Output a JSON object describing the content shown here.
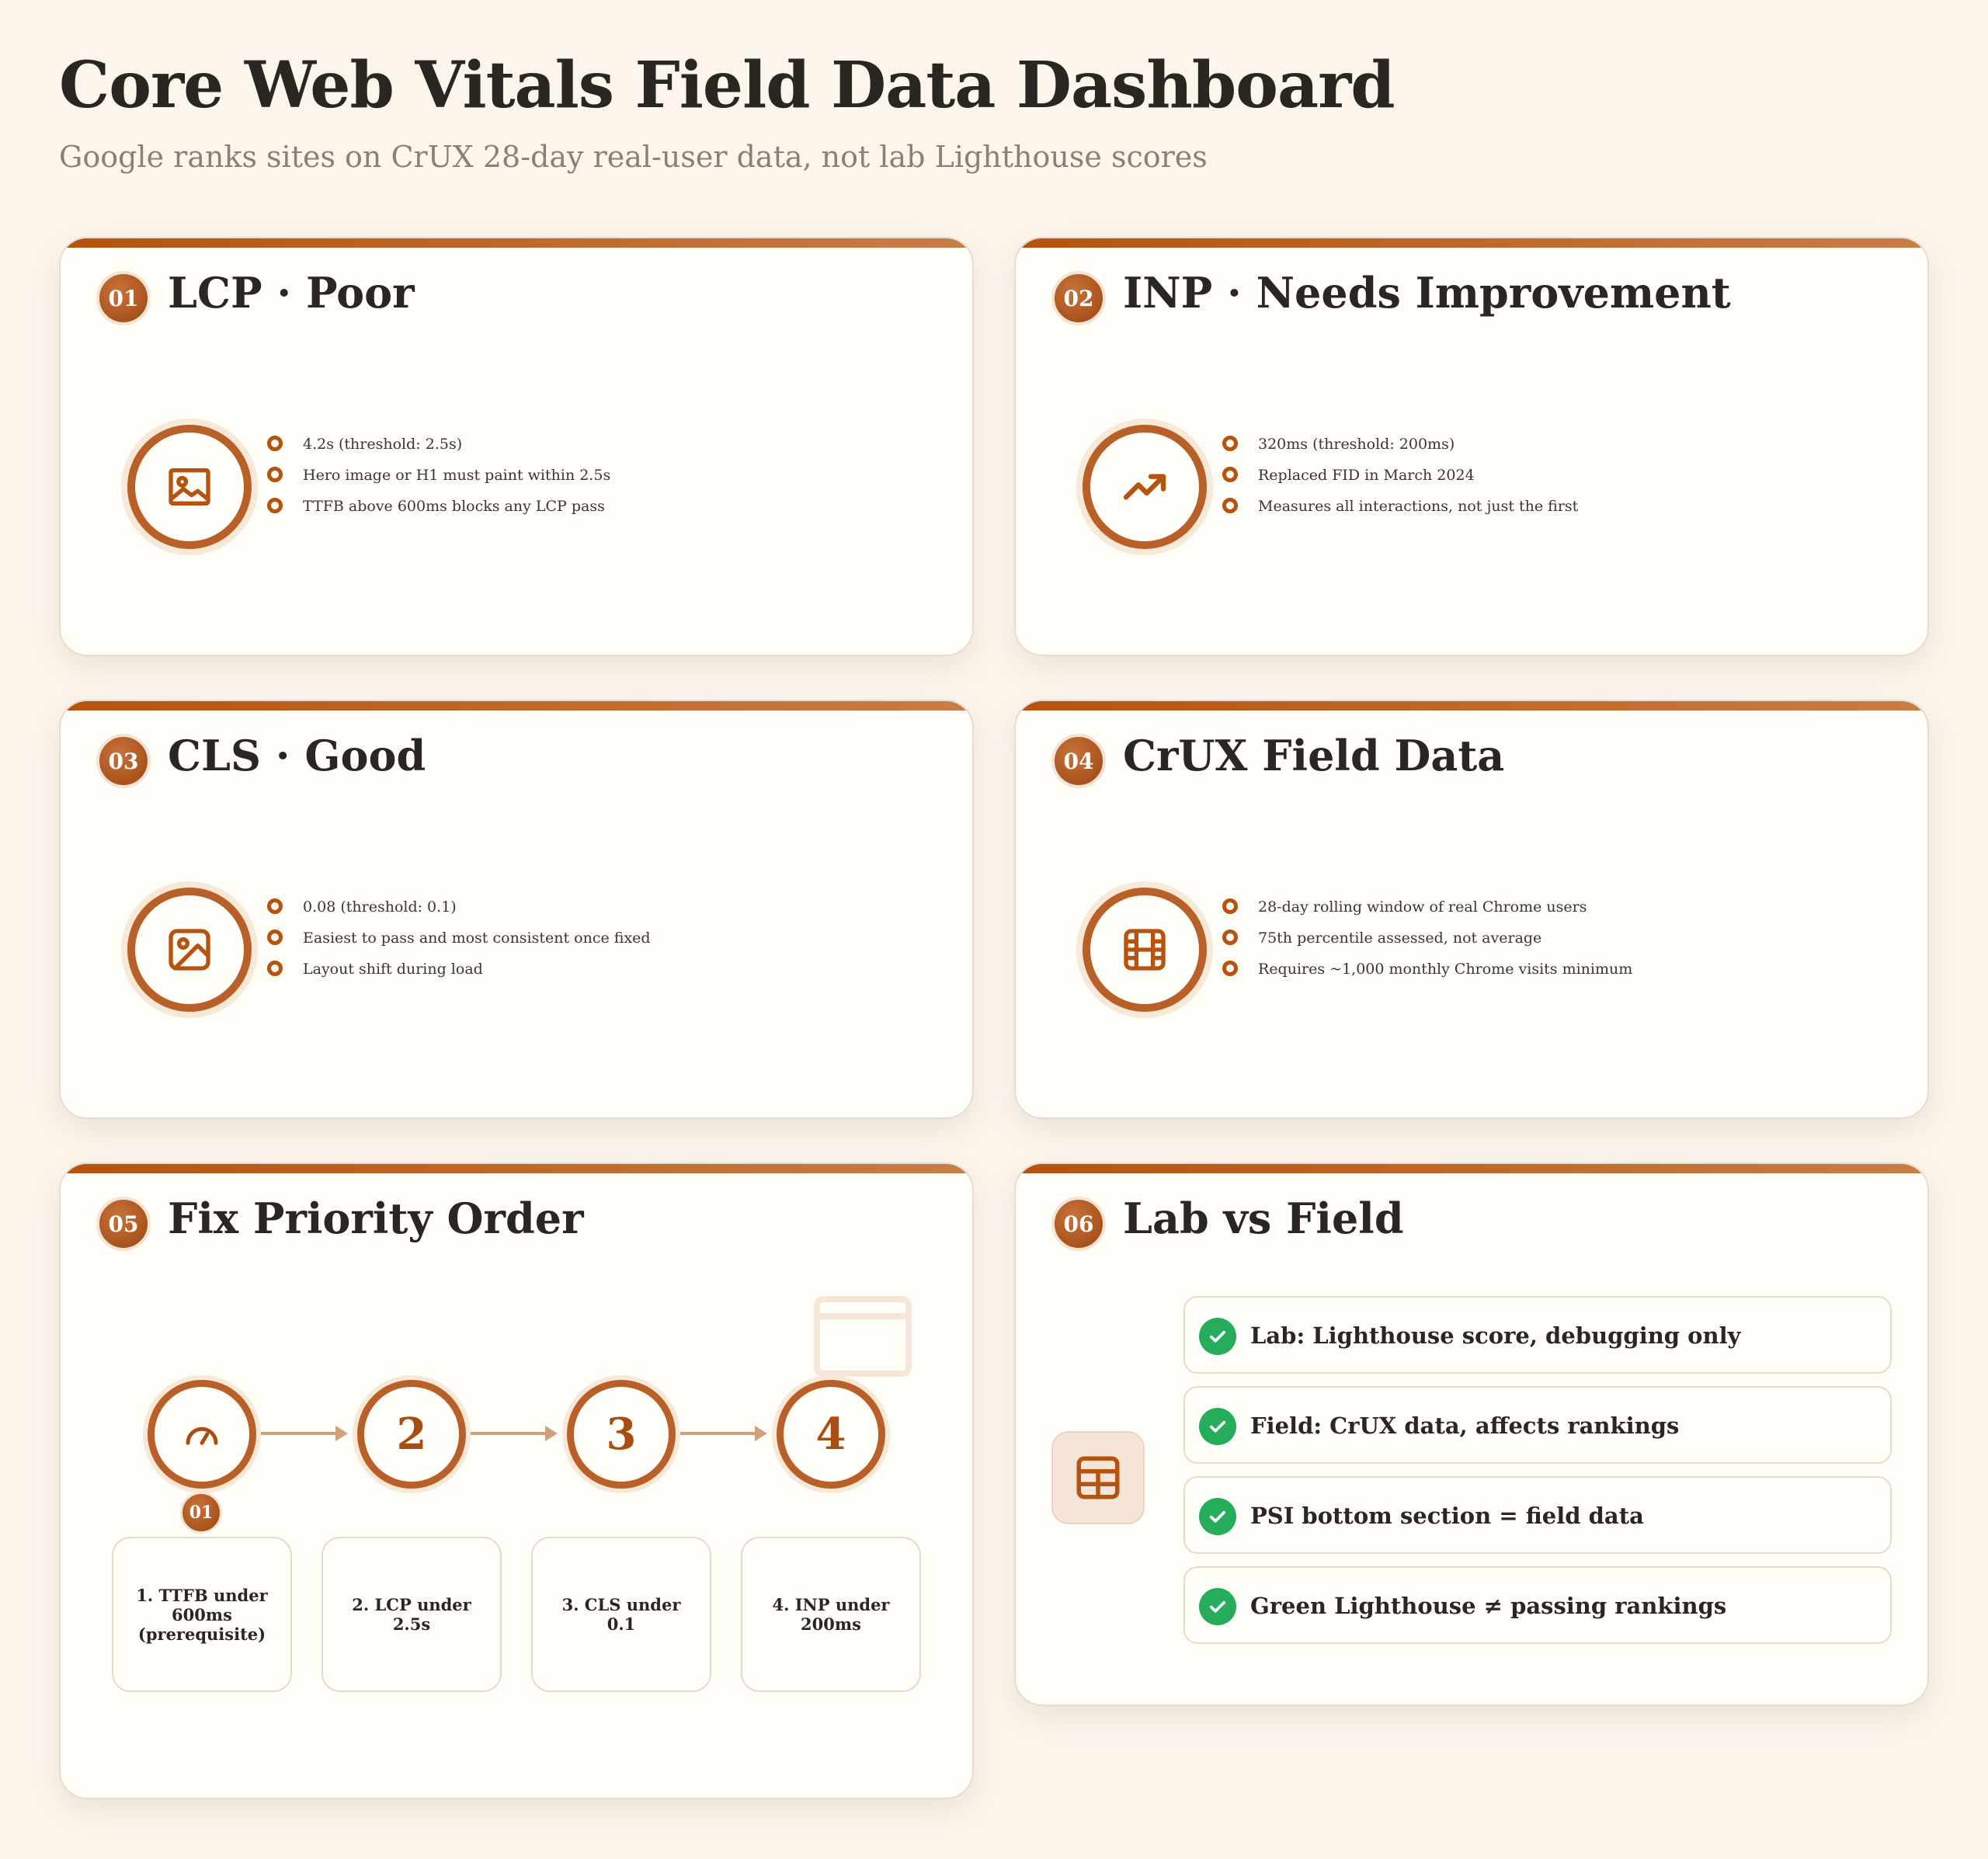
{
  "header": {
    "title": "Core Web Vitals Field Data Dashboard",
    "subtitle": "Google ranks sites on CrUX 28-day real-user data, not lab Lighthouse scores"
  },
  "cards": [
    {
      "number": "01",
      "title": "LCP · Poor",
      "icon": "image-icon",
      "bullets": [
        "4.2s (threshold: 2.5s)",
        "Hero image or H1 must paint within 2.5s",
        "TTFB above 600ms blocks any LCP pass"
      ]
    },
    {
      "number": "02",
      "title": "INP · Needs Improvement",
      "icon": "trending-up-icon",
      "bullets": [
        "320ms (threshold: 200ms)",
        "Replaced FID in March 2024",
        "Measures all interactions, not just the first"
      ]
    },
    {
      "number": "03",
      "title": "CLS · Good",
      "icon": "image-frame-icon",
      "bullets": [
        "0.08 (threshold: 0.1)",
        "Easiest to pass and most consistent once fixed",
        "Layout shift during load"
      ]
    },
    {
      "number": "04",
      "title": "CrUX Field Data",
      "icon": "film-icon",
      "bullets": [
        "28-day rolling window of real Chrome users",
        "75th percentile assessed, not average",
        "Requires ~1,000 monthly Chrome visits minimum"
      ]
    },
    {
      "number": "05",
      "title": "Fix Priority Order",
      "steps": [
        {
          "marker": "",
          "icon": "gauge-icon",
          "label": "1. TTFB under 600ms (prerequisite)"
        },
        {
          "marker": "2",
          "label": "2. LCP under 2.5s"
        },
        {
          "marker": "3",
          "label": "3. CLS under 0.1"
        },
        {
          "marker": "4",
          "label": "4. INP under 200ms"
        }
      ],
      "active_badge": "01"
    },
    {
      "number": "06",
      "title": "Lab vs Field",
      "icon": "table-icon",
      "checks": [
        "Lab: Lighthouse score, debugging only",
        "Field: CrUX data, affects rankings",
        "PSI bottom section = field data",
        "Green Lighthouse ≠ passing rankings"
      ]
    }
  ],
  "colors": {
    "accent": "#b5530f",
    "background": "#fbf5ec",
    "card": "#fffdf8",
    "check": "#26ad5b"
  }
}
